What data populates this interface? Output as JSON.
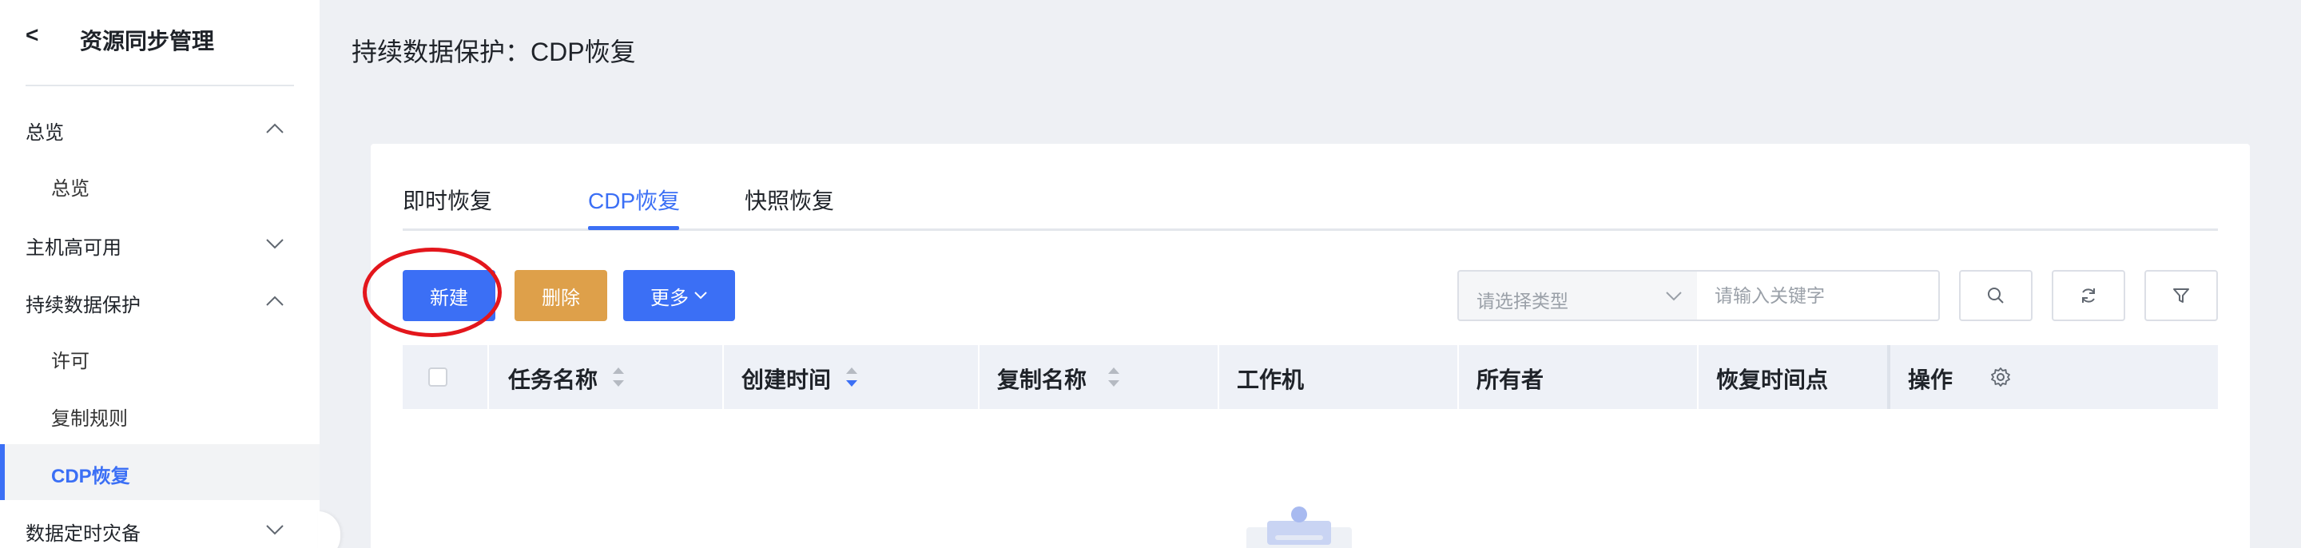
{
  "sidebar": {
    "back_label": "<",
    "title": "资源同步管理",
    "groups": [
      {
        "label": "总览",
        "expanded": true,
        "items": [
          {
            "label": "总览"
          }
        ]
      },
      {
        "label": "主机高可用",
        "expanded": false,
        "items": []
      },
      {
        "label": "持续数据保护",
        "expanded": true,
        "items": [
          {
            "label": "许可"
          },
          {
            "label": "复制规则"
          },
          {
            "label": "CDP恢复",
            "active": true
          }
        ]
      },
      {
        "label": "数据定时灾备",
        "expanded": false,
        "items": []
      }
    ]
  },
  "page": {
    "title": "持续数据保护：CDP恢复"
  },
  "tabs": [
    {
      "label": "即时恢复",
      "active": false
    },
    {
      "label": "CDP恢复",
      "active": true
    },
    {
      "label": "快照恢复",
      "active": false
    }
  ],
  "toolbar": {
    "new_label": "新建",
    "delete_label": "删除",
    "more_label": "更多",
    "type_select_placeholder": "请选择类型",
    "keyword_placeholder": "请输入关键字"
  },
  "table": {
    "columns": [
      {
        "label": "任务名称",
        "sortable": true,
        "sort": "none"
      },
      {
        "label": "创建时间",
        "sortable": true,
        "sort": "descending"
      },
      {
        "label": "复制名称",
        "sortable": true,
        "sort": "none"
      },
      {
        "label": "工作机",
        "sortable": false
      },
      {
        "label": "所有者",
        "sortable": false
      },
      {
        "label": "恢复时间点",
        "sortable": false
      },
      {
        "label": "操作",
        "sortable": false
      }
    ],
    "rows": []
  },
  "colors": {
    "accent": "#3b6ff5",
    "delete": "#dea04a",
    "highlight": "#e3161c"
  }
}
